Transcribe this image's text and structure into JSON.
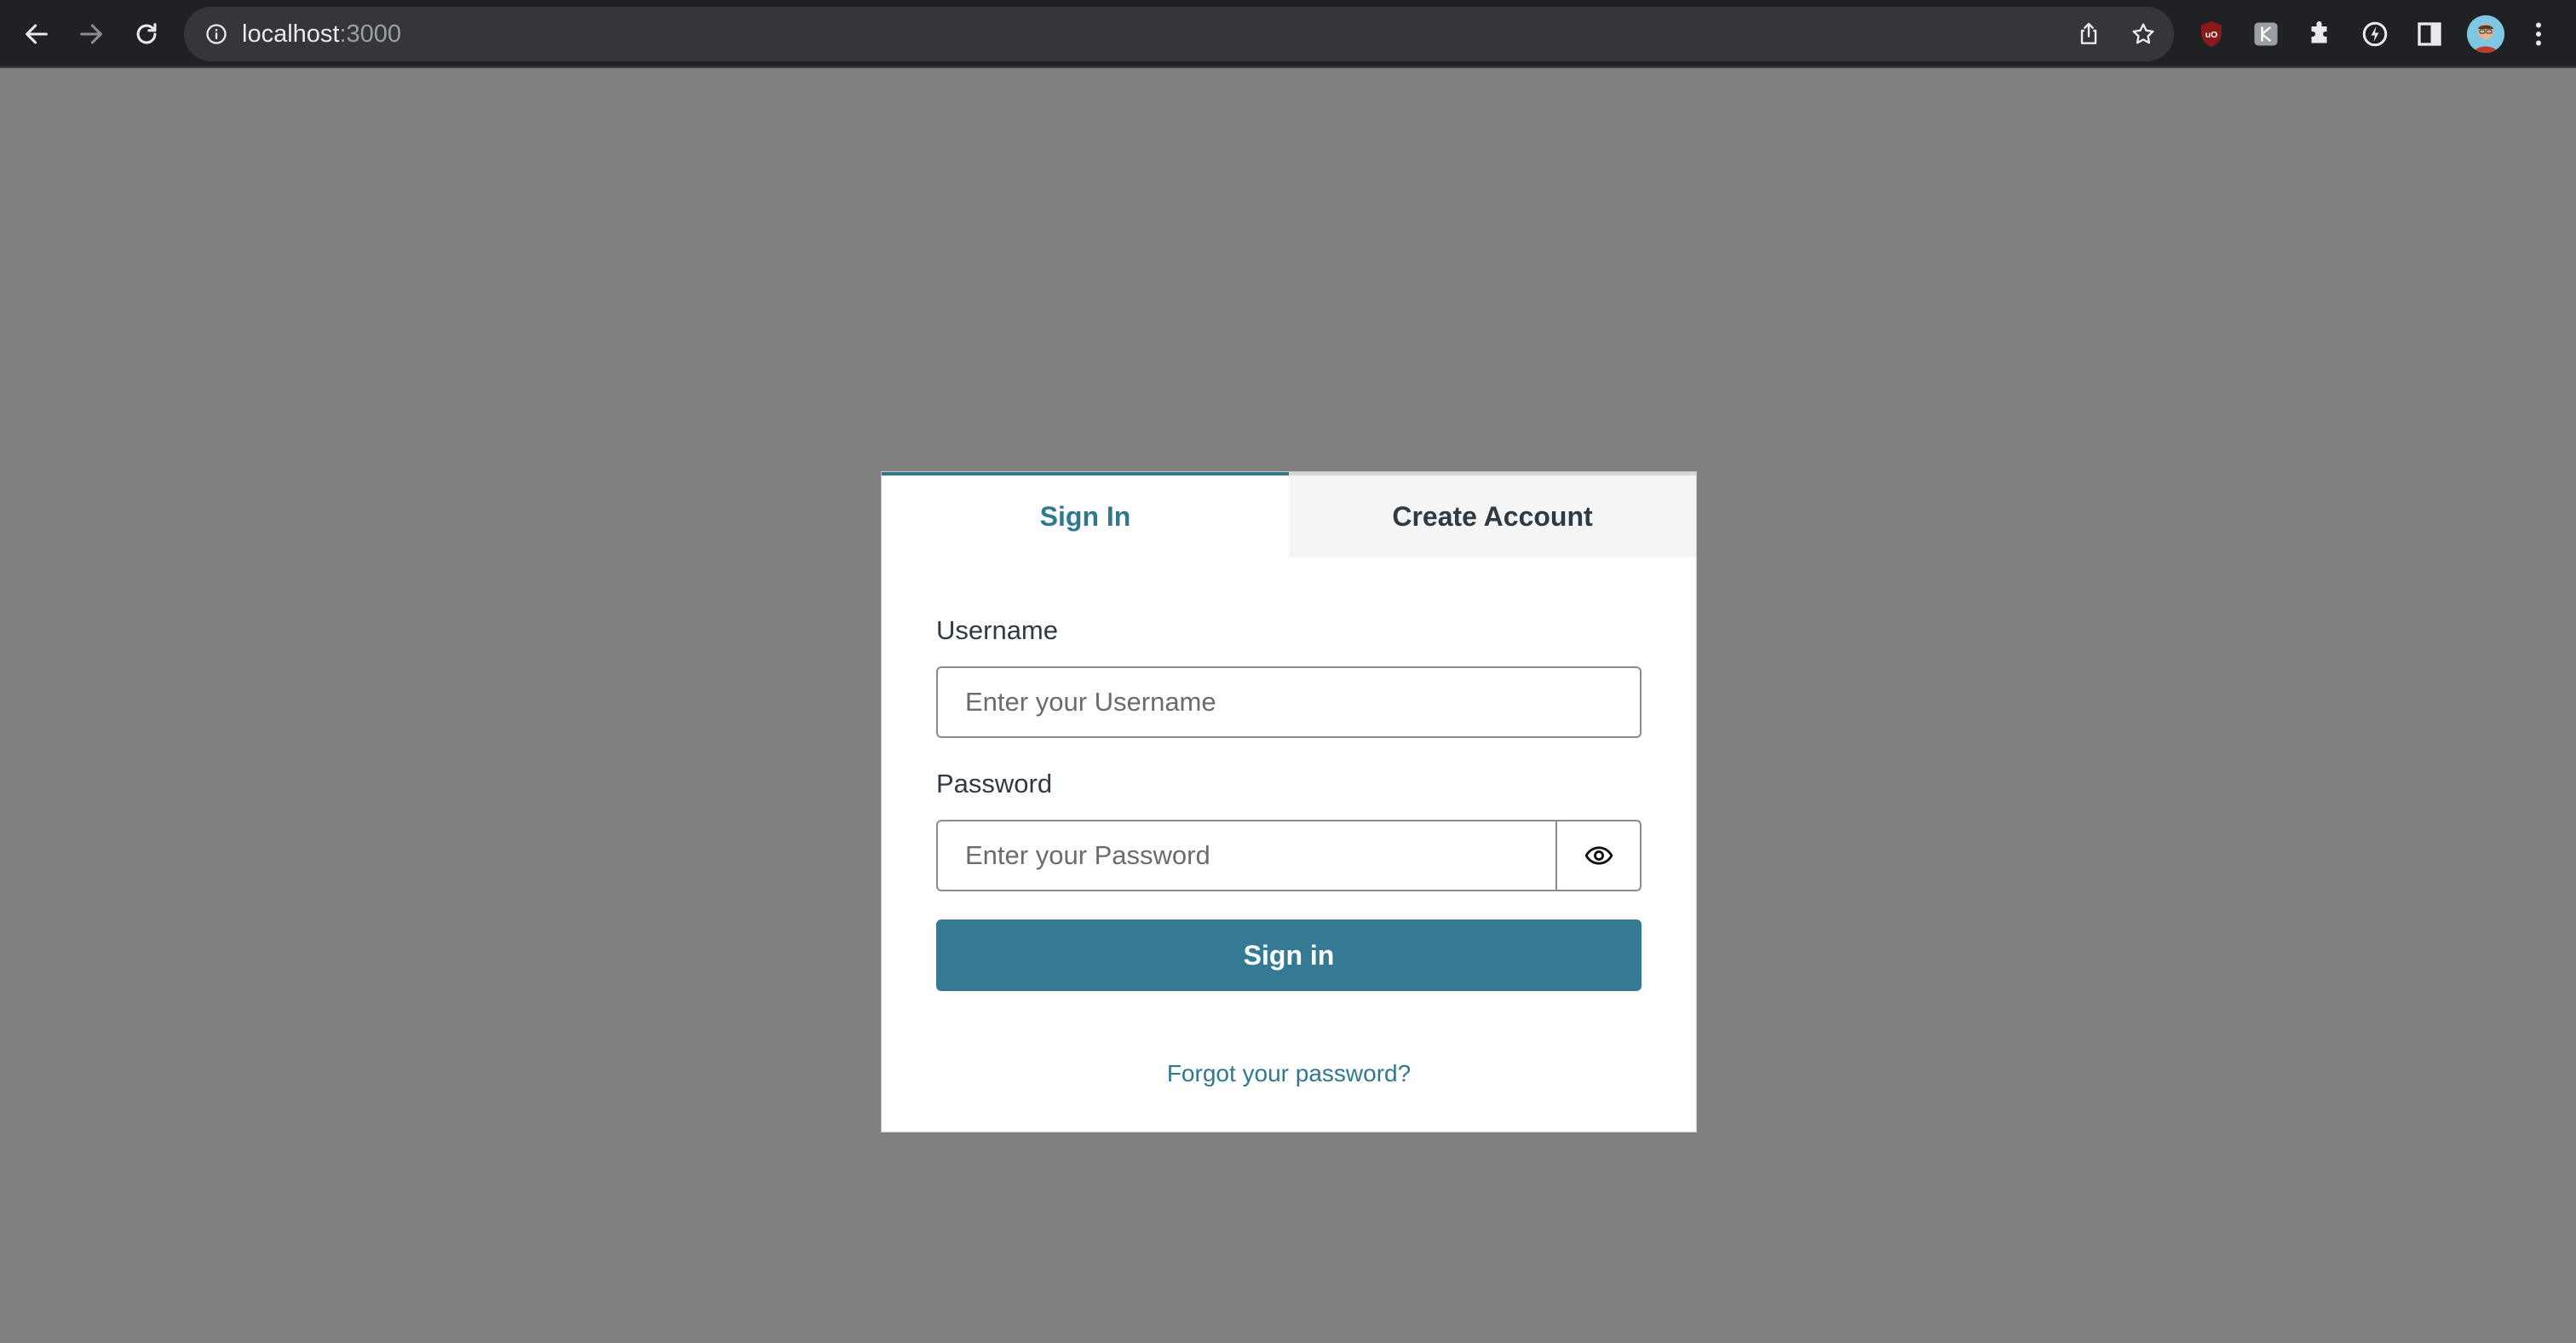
{
  "browser": {
    "url_host": "localhost",
    "url_port": ":3000",
    "icons": {
      "back": "arrow-left-icon",
      "forward": "arrow-right-icon",
      "reload": "reload-icon",
      "site_info": "info-icon",
      "share": "share-icon",
      "bookmark": "star-icon",
      "extensions": [
        "ublock-icon",
        "extension-badge-icon",
        "puzzle-icon",
        "speed-icon",
        "side-panel-icon"
      ],
      "menu": "kebab-menu-icon"
    },
    "colors": {
      "chrome_bg": "#202124",
      "omnibox_bg": "#35363a"
    }
  },
  "auth": {
    "tabs": {
      "sign_in": "Sign In",
      "create_account": "Create Account"
    },
    "username": {
      "label": "Username",
      "placeholder": "Enter your Username"
    },
    "password": {
      "label": "Password",
      "placeholder": "Enter your Password",
      "toggle_icon": "eye-icon"
    },
    "submit_label": "Sign in",
    "forgot_label": "Forgot your password?",
    "colors": {
      "accent": "#31788f",
      "button": "#357a93",
      "backdrop": "#808080"
    }
  }
}
